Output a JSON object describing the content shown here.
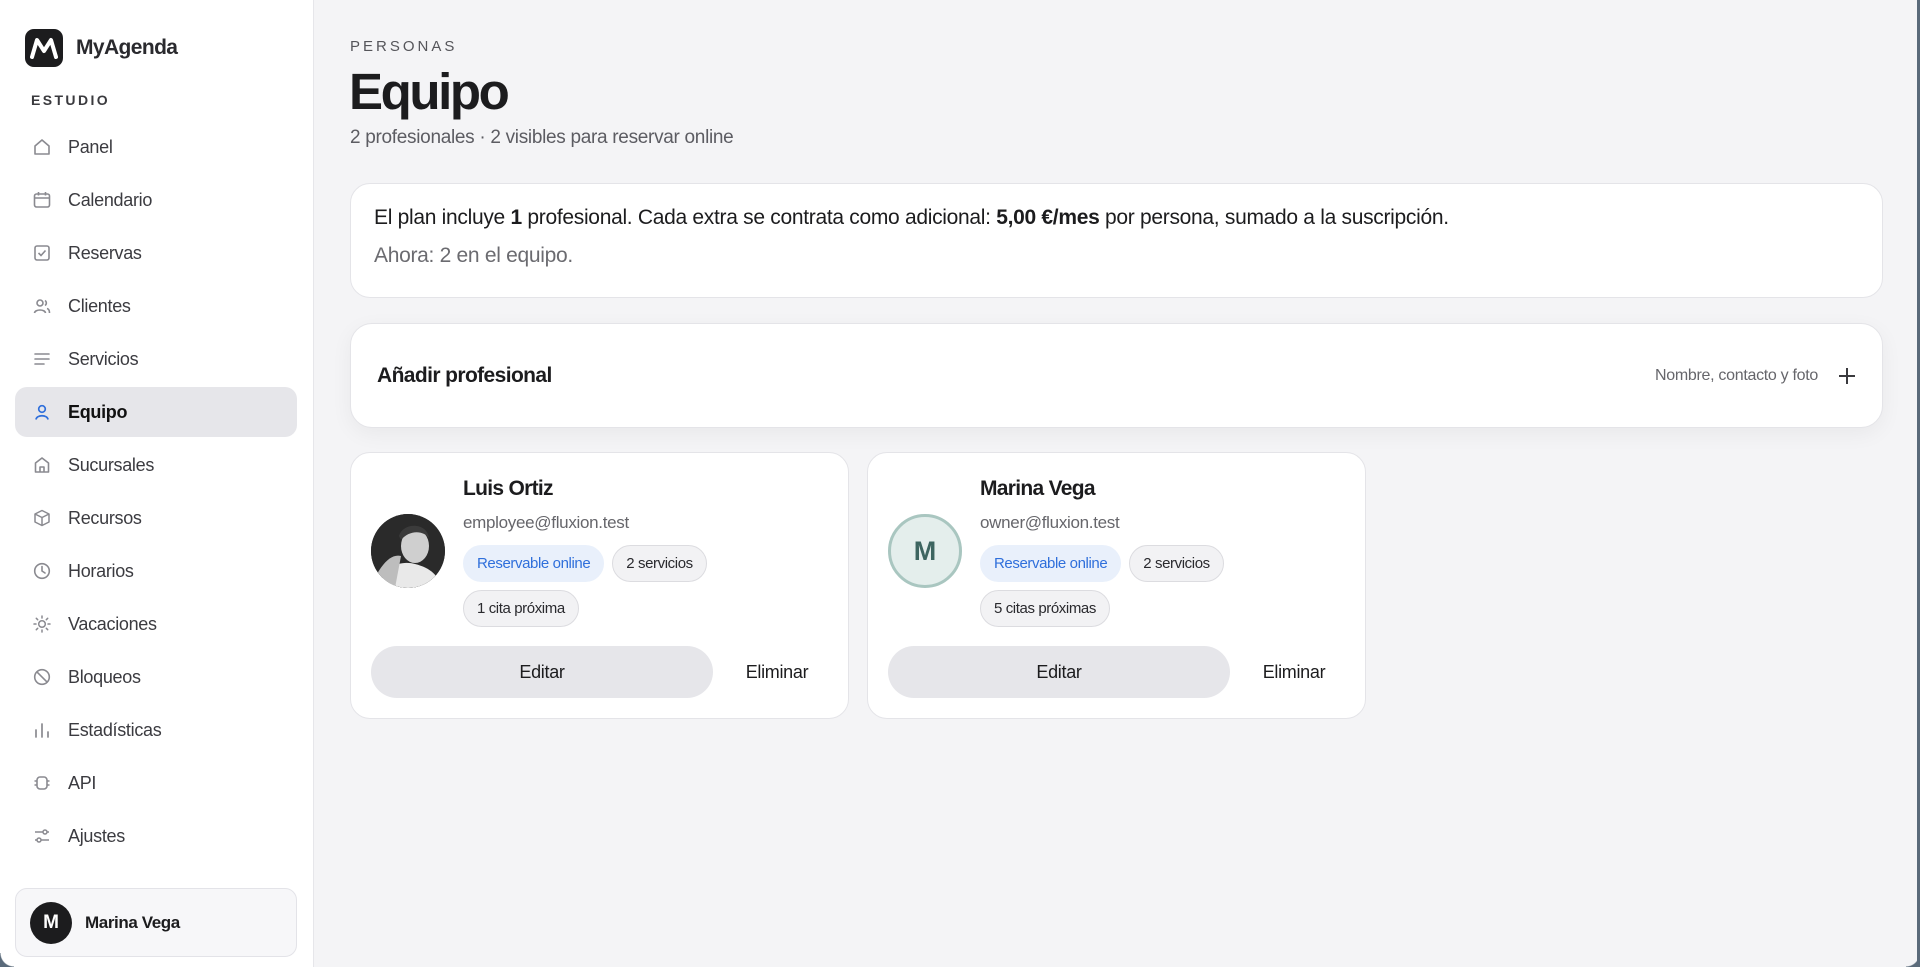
{
  "brand": {
    "name": "MyAgenda"
  },
  "sidebar": {
    "section": "ESTUDIO",
    "items": [
      {
        "label": "Panel",
        "icon": "home-icon"
      },
      {
        "label": "Calendario",
        "icon": "calendar-icon"
      },
      {
        "label": "Reservas",
        "icon": "checkbox-icon"
      },
      {
        "label": "Clientes",
        "icon": "users-icon"
      },
      {
        "label": "Servicios",
        "icon": "list-icon"
      },
      {
        "label": "Equipo",
        "icon": "user-icon",
        "active": true
      },
      {
        "label": "Sucursales",
        "icon": "building-icon"
      },
      {
        "label": "Recursos",
        "icon": "box-icon"
      },
      {
        "label": "Horarios",
        "icon": "clock-icon"
      },
      {
        "label": "Vacaciones",
        "icon": "sun-icon"
      },
      {
        "label": "Bloqueos",
        "icon": "ban-icon"
      },
      {
        "label": "Estadísticas",
        "icon": "bar-chart-icon"
      },
      {
        "label": "API",
        "icon": "api-icon"
      },
      {
        "label": "Ajustes",
        "icon": "sliders-icon"
      }
    ],
    "user": {
      "initial": "M",
      "name": "Marina Vega"
    }
  },
  "header": {
    "eyebrow": "PERSONAS",
    "title": "Equipo",
    "subtitle": "2 profesionales · 2 visibles para reservar online"
  },
  "plan": {
    "text_1": "El plan incluye ",
    "count": "1",
    "text_2": " profesional. Cada extra se contrata como adicional: ",
    "price": "5,00 €/mes",
    "text_3": " por persona, sumado a la suscripción.",
    "now": "Ahora: 2 en el equipo."
  },
  "add": {
    "title": "Añadir profesional",
    "hint": "Nombre, contacto y foto"
  },
  "team": [
    {
      "name": "Luis Ortiz",
      "email": "employee@fluxion.test",
      "avatar_initial": "",
      "chips": [
        "Reservable online",
        "2 servicios",
        "1 cita próxima"
      ],
      "edit": "Editar",
      "delete": "Eliminar"
    },
    {
      "name": "Marina Vega",
      "email": "owner@fluxion.test",
      "avatar_initial": "M",
      "chips": [
        "Reservable online",
        "2 servicios",
        "5 citas próximas"
      ],
      "edit": "Editar",
      "delete": "Eliminar"
    }
  ],
  "colors": {
    "accent": "#2f6fdb",
    "active_bg": "#e6e6ea",
    "avatar_ring": "#a9c6c0"
  }
}
